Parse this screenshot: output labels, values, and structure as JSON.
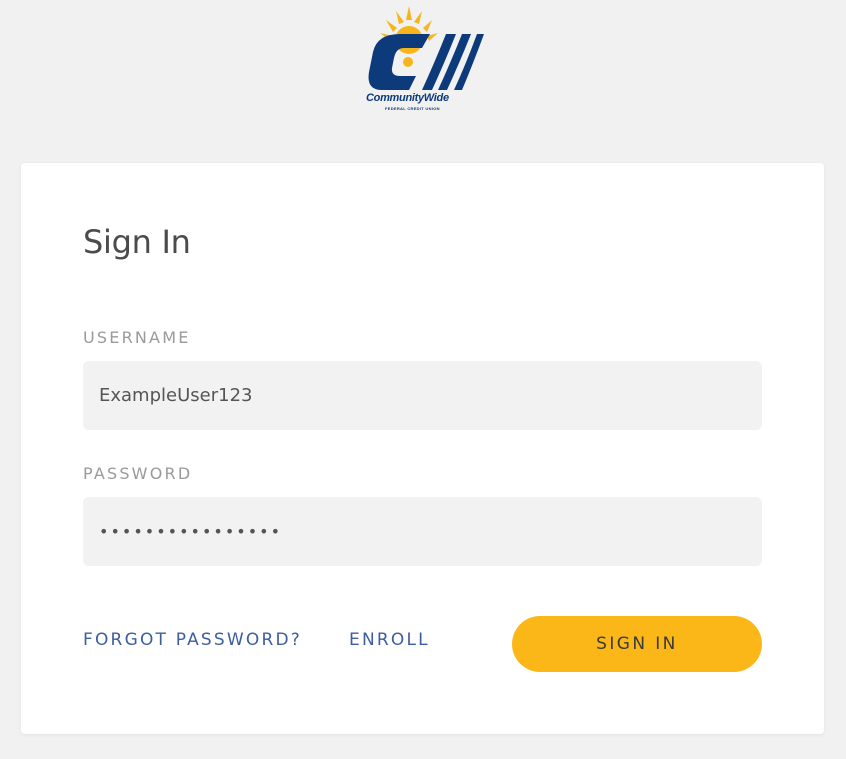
{
  "brand": {
    "name": "CommunityWide",
    "subtitle": "FEDERAL CREDIT UNION",
    "colors": {
      "navy": "#0d3a7a",
      "sun": "#f6b51a"
    }
  },
  "form": {
    "title": "Sign In",
    "username_label": "USERNAME",
    "username_value": "ExampleUser123",
    "password_label": "PASSWORD",
    "password_value": "mysecretpasswd12",
    "forgot_label": "FORGOT PASSWORD?",
    "enroll_label": "ENROLL",
    "signin_label": "SIGN IN"
  },
  "colors": {
    "background": "#f1f1f1",
    "card": "#ffffff",
    "field_bg": "#f2f2f2",
    "link": "#3d5e9e",
    "button": "#fbb718"
  }
}
